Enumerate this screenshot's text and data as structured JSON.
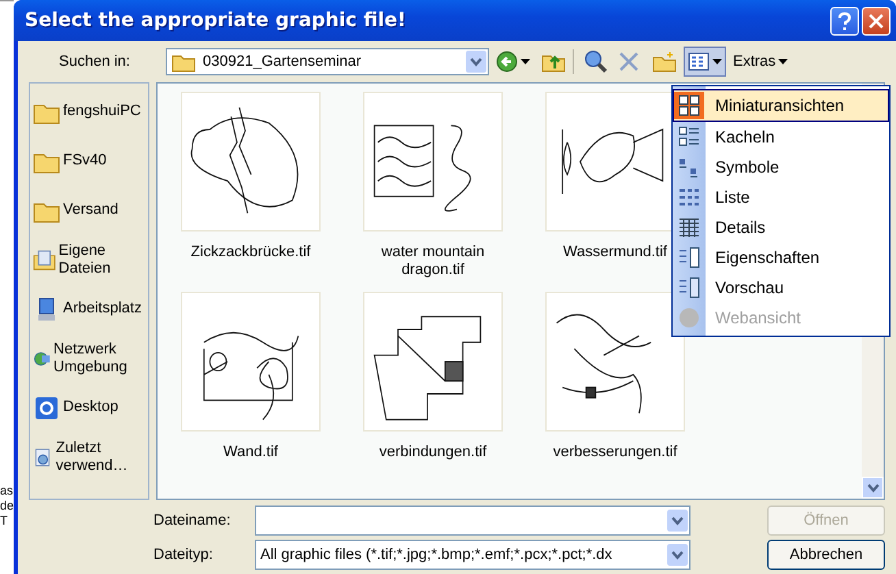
{
  "background_window": {
    "fragments": [
      "as",
      "de",
      "T"
    ]
  },
  "window": {
    "title": "Select the appropriate graphic file!"
  },
  "toolbar": {
    "look_in_label": "Suchen in:",
    "look_in_value": "030921_Gartenseminar",
    "views_pressed": true,
    "extras": "Extras"
  },
  "places": [
    {
      "label": "fengshuiPC",
      "kind": "folder"
    },
    {
      "label": "FSv40",
      "kind": "folder"
    },
    {
      "label": "Versand",
      "kind": "folder"
    },
    {
      "label": "Eigene Dateien",
      "kind": "documents"
    },
    {
      "label": "Arbeitsplatz",
      "kind": "computer"
    },
    {
      "label": "Netzwerk Umgebung",
      "kind": "network"
    },
    {
      "label": "Desktop",
      "kind": "desktop"
    },
    {
      "label": "Zuletzt verwend…",
      "kind": "recent"
    }
  ],
  "files": [
    {
      "name": "Zickzackbrücke.tif",
      "kind": "zigzag"
    },
    {
      "name": "water mountain dragon.tif",
      "kind": "waves"
    },
    {
      "name": "Wassermund.tif",
      "kind": "mouth"
    },
    {
      "name": "Wand.tif",
      "kind": "wall"
    },
    {
      "name": "verbindungen.tif",
      "kind": "plan"
    },
    {
      "name": "verbesserungen.tif",
      "kind": "map"
    }
  ],
  "views_menu": [
    {
      "label": "Miniaturansichten",
      "kind": "thumbs",
      "selected": true,
      "disabled": false
    },
    {
      "label": "Kacheln",
      "kind": "tiles",
      "selected": false,
      "disabled": false
    },
    {
      "label": "Symbole",
      "kind": "icons",
      "selected": false,
      "disabled": false
    },
    {
      "label": "Liste",
      "kind": "list",
      "selected": false,
      "disabled": false
    },
    {
      "label": "Details",
      "kind": "details",
      "selected": false,
      "disabled": false
    },
    {
      "label": "Eigenschaften",
      "kind": "props",
      "selected": false,
      "disabled": false
    },
    {
      "label": "Vorschau",
      "kind": "preview",
      "selected": false,
      "disabled": false
    },
    {
      "label": "Webansicht",
      "kind": "web",
      "selected": false,
      "disabled": true
    }
  ],
  "filename": {
    "label": "Dateiname:"
  },
  "filetype": {
    "label": "Dateityp:",
    "value": "All graphic files (*.tif;*.jpg;*.bmp;*.emf;*.pcx;*.pct;*.dx"
  },
  "buttons": [
    {
      "label": "Öffnen",
      "disabled": true
    },
    {
      "label": "Abbrechen",
      "disabled": false
    }
  ]
}
